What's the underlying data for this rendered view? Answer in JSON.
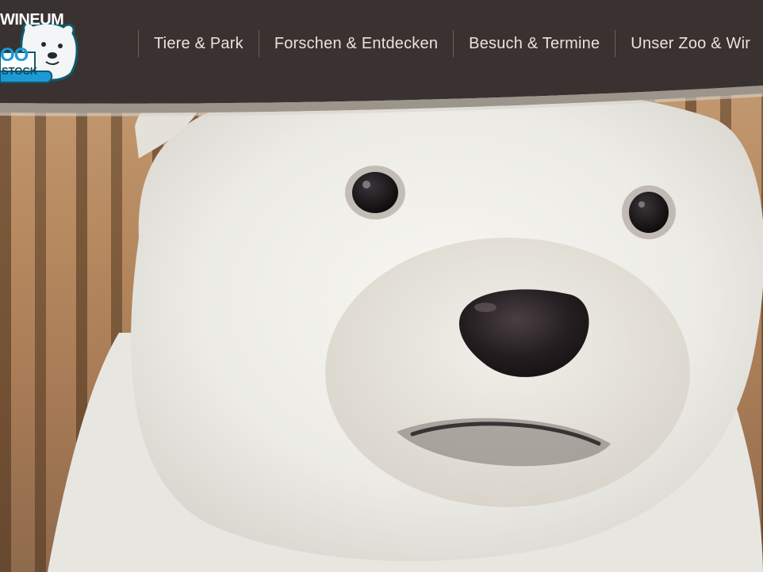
{
  "site": {
    "logo": {
      "top_text_visible": "WINEUM",
      "main_text_visible": "OO",
      "sub_text_visible": "STOCK",
      "icon": "polar-bear-head-icon"
    }
  },
  "nav": {
    "items": [
      {
        "label": "Tiere & Park"
      },
      {
        "label": "Forschen & Entdecken"
      },
      {
        "label": "Besuch & Termine"
      },
      {
        "label": "Unser Zoo & Wir"
      }
    ]
  },
  "hero": {
    "image": "polar-bear-cub-closeup"
  },
  "colors": {
    "header_background": "#3a3230",
    "nav_text": "#e9e3dc",
    "nav_divider": "#6b615b",
    "logo_blue": "#1d9ad6",
    "logo_teal_outline": "#0e5a6e"
  }
}
